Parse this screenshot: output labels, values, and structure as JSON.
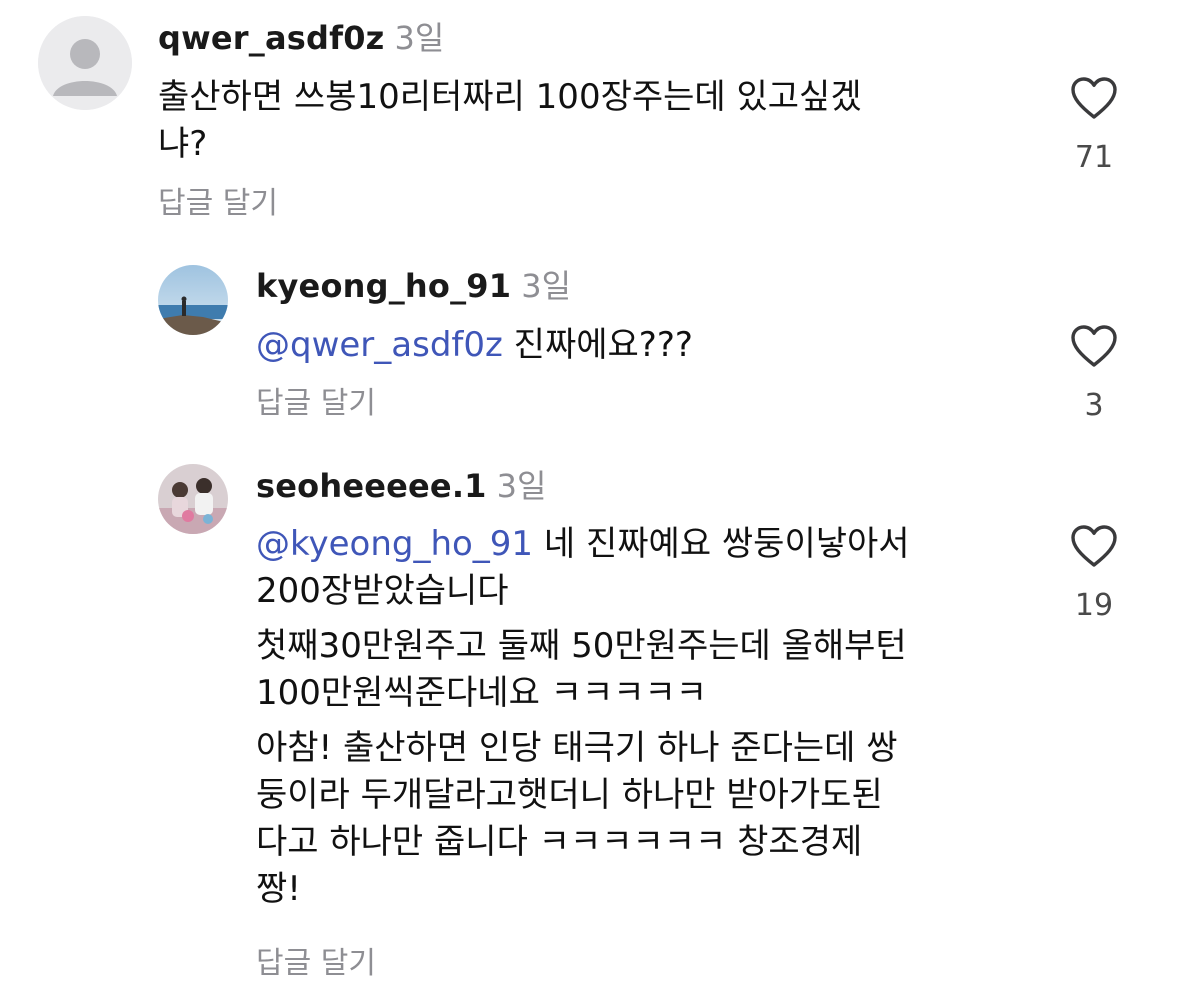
{
  "comments": [
    {
      "username": "qwer_asdf0z",
      "time": "3일",
      "text_line1": "출산하면 쓰봉10리터짜리 100장주는데 있고싶겠",
      "text_line2": "냐?",
      "reply_label": "답글 달기",
      "like_count": "71"
    },
    {
      "username": "kyeong_ho_91",
      "time": "3일",
      "mention": "@qwer_asdf0z",
      "text": " 진짜에요???",
      "reply_label": "답글 달기",
      "like_count": "3"
    },
    {
      "username": "seoheeeee.1",
      "time": "3일",
      "mention": "@kyeong_ho_91",
      "para1_line1": " 네 진짜예요 쌍둥이낳아서",
      "para1_line2": "200장받았습니다",
      "para2_line1": "첫째30만원주고 둘째 50만원주는데 올해부턴",
      "para2_line2": "100만원씩준다네요 ㅋㅋㅋㅋㅋ",
      "para3_line1": "아참! 출산하면 인당 태극기 하나 준다는데 쌍",
      "para3_line2": "둥이라 두개달라고햇더니 하나만 받아가도된",
      "para3_line3": "다고 하나만 줍니다 ㅋㅋㅋㅋㅋㅋ 창조경제",
      "para3_line4": "짱!",
      "reply_label": "답글 달기",
      "like_count": "19"
    }
  ],
  "icons": {
    "like": "heart-outline-icon",
    "default_avatar": "person-silhouette-icon"
  },
  "colors": {
    "mention": "#3f56b8",
    "muted": "#8e8e93",
    "text": "#111111"
  }
}
